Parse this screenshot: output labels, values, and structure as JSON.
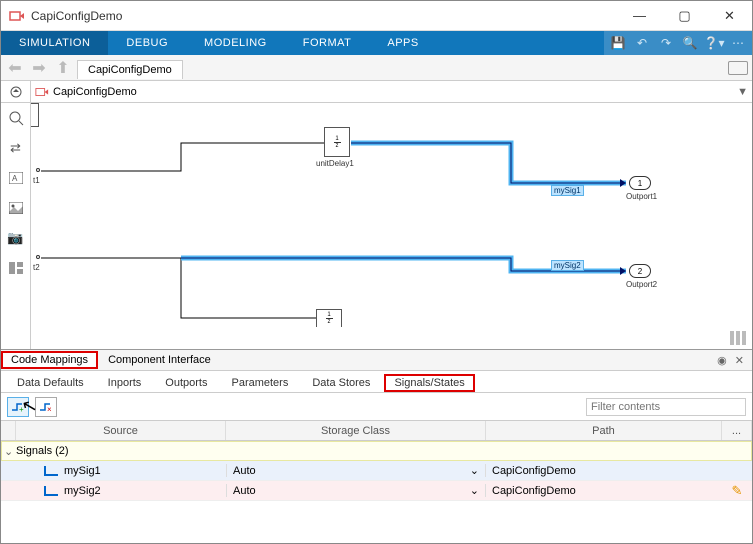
{
  "window": {
    "title": "CapiConfigDemo"
  },
  "toolstrip": {
    "tabs": [
      "SIMULATION",
      "DEBUG",
      "MODELING",
      "FORMAT",
      "APPS"
    ]
  },
  "nav": {
    "tab": "CapiConfigDemo"
  },
  "model": {
    "path": "CapiConfigDemo"
  },
  "canvas": {
    "block_unitDelay": "unitDelay1",
    "port_t1": "t1",
    "port_t2": "t2",
    "sig1": "mySig1",
    "sig2": "mySig2",
    "out1_num": "1",
    "out1_label": "Outport1",
    "out2_num": "2",
    "out2_label": "Outport2"
  },
  "panel": {
    "tab_code_mappings": "Code Mappings",
    "tab_component_if": "Component Interface"
  },
  "subtabs": {
    "t1": "Data Defaults",
    "t2": "Inports",
    "t3": "Outports",
    "t4": "Parameters",
    "t5": "Data Stores",
    "t6": "Signals/States"
  },
  "filter": {
    "placeholder": "Filter contents"
  },
  "grid": {
    "h_source": "Source",
    "h_storage": "Storage Class",
    "h_path": "Path",
    "h_more": "...",
    "group": "Signals (2)",
    "rows": [
      {
        "source": "mySig1",
        "storage": "Auto",
        "path": "CapiConfigDemo"
      },
      {
        "source": "mySig2",
        "storage": "Auto",
        "path": "CapiConfigDemo"
      }
    ]
  }
}
